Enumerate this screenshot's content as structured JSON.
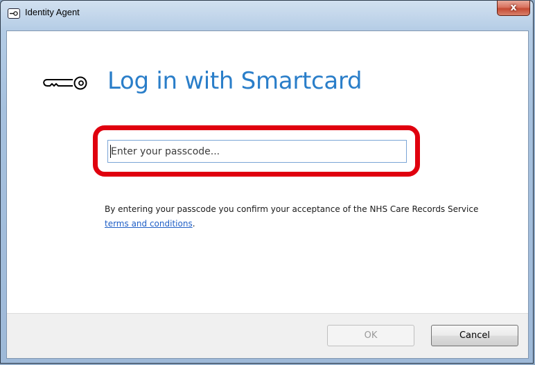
{
  "window": {
    "title": "Identity Agent",
    "close_label": "x"
  },
  "main": {
    "heading": "Log in with Smartcard",
    "passcode_placeholder": "Enter your passcode...",
    "passcode_value": "",
    "disclaimer_text": "By entering your passcode you confirm your acceptance of the NHS Care Records Service ",
    "terms_link": "terms and conditions",
    "disclaimer_end": "."
  },
  "footer": {
    "ok_label": "OK",
    "cancel_label": "Cancel"
  },
  "icons": {
    "app": "key-icon",
    "heading": "key-icon",
    "close": "close-icon"
  },
  "colors": {
    "heading": "#2a7ec9",
    "highlight": "#e0000e",
    "link": "#1f5fc6",
    "close_button": "#c54a33"
  }
}
